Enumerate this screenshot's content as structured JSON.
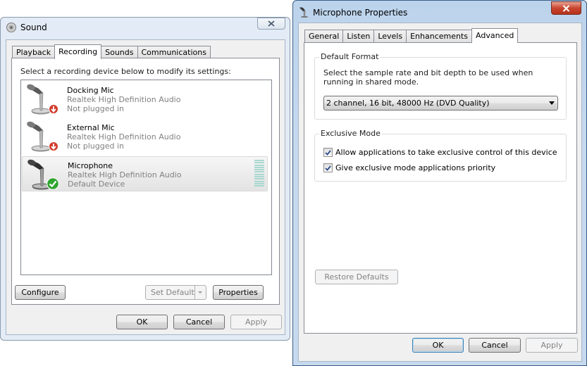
{
  "sound_window": {
    "title": "Sound",
    "tabs": [
      {
        "label": "Playback"
      },
      {
        "label": "Recording"
      },
      {
        "label": "Sounds"
      },
      {
        "label": "Communications"
      }
    ],
    "active_tab": "Recording",
    "instruction": "Select a recording device below to modify its settings:",
    "devices": [
      {
        "name": "Docking Mic",
        "driver": "Realtek High Definition Audio",
        "status": "Not plugged in",
        "status_icon": "red-down-arrow-icon"
      },
      {
        "name": "External Mic",
        "driver": "Realtek High Definition Audio",
        "status": "Not plugged in",
        "status_icon": "red-down-arrow-icon"
      },
      {
        "name": "Microphone",
        "driver": "Realtek High Definition Audio",
        "status": "Default Device",
        "status_icon": "green-check-icon",
        "selected": true
      }
    ],
    "buttons": {
      "configure": "Configure",
      "set_default": "Set Default",
      "properties": "Properties",
      "ok": "OK",
      "cancel": "Cancel",
      "apply": "Apply"
    }
  },
  "props_window": {
    "title": "Microphone Properties",
    "tabs": [
      {
        "label": "General"
      },
      {
        "label": "Listen"
      },
      {
        "label": "Levels"
      },
      {
        "label": "Enhancements"
      },
      {
        "label": "Advanced"
      }
    ],
    "active_tab": "Advanced",
    "default_format": {
      "group_label": "Default Format",
      "description": "Select the sample rate and bit depth to be used when running in shared mode.",
      "selected": "2 channel, 16 bit, 48000 Hz (DVD Quality)"
    },
    "exclusive_mode": {
      "group_label": "Exclusive Mode",
      "options": [
        {
          "label": "Allow applications to take exclusive control of this device",
          "checked": true
        },
        {
          "label": "Give exclusive mode applications priority",
          "checked": true
        }
      ]
    },
    "buttons": {
      "restore_defaults": "Restore Defaults",
      "ok": "OK",
      "cancel": "Cancel",
      "apply": "Apply"
    }
  },
  "colors": {
    "window_frame": "#e3ecf6",
    "active_frame": "#c5d9ef",
    "check_green": "#2fa52f",
    "unplugged_red": "#d23a2a",
    "level_meter": "#a9d7cf"
  }
}
